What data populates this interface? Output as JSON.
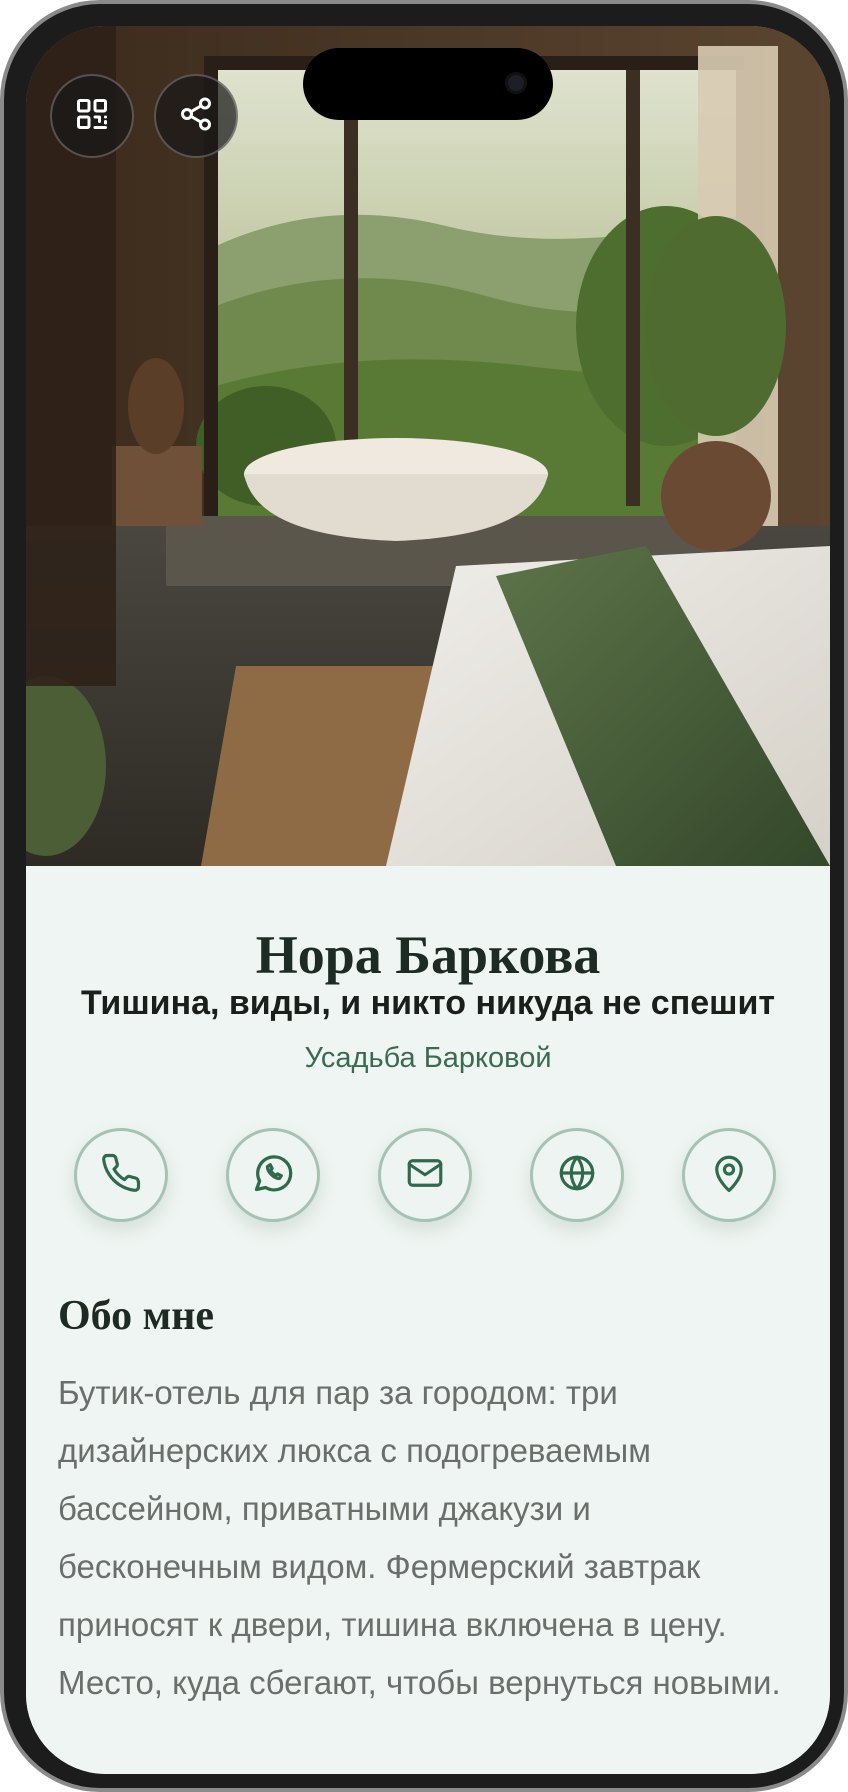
{
  "profile": {
    "name": "Нора Баркова",
    "tagline": "Тишина, виды, и никто никуда не спешит",
    "company": "Усадьба Барковой"
  },
  "header_buttons": [
    {
      "icon": "qr-code-icon"
    },
    {
      "icon": "share-icon"
    }
  ],
  "actions": [
    {
      "icon": "phone-icon"
    },
    {
      "icon": "whatsapp-icon"
    },
    {
      "icon": "mail-icon"
    },
    {
      "icon": "globe-icon"
    },
    {
      "icon": "map-pin-icon"
    }
  ],
  "about": {
    "title": "Обо мне",
    "text": "Бутик-отель для пар за городом: три дизайнерских люкса с подогреваемым бассейном, приватными джакузи и бесконечным видом. Фермерский завтрак приносят к двери, тишина включена в цену. Место, куда сбегают, чтобы вернуться новыми."
  },
  "colors": {
    "accent": "#2f6a4c",
    "background": "#eff5f2",
    "text_dark": "#1d2b24",
    "text_muted": "#6a6f6c"
  }
}
